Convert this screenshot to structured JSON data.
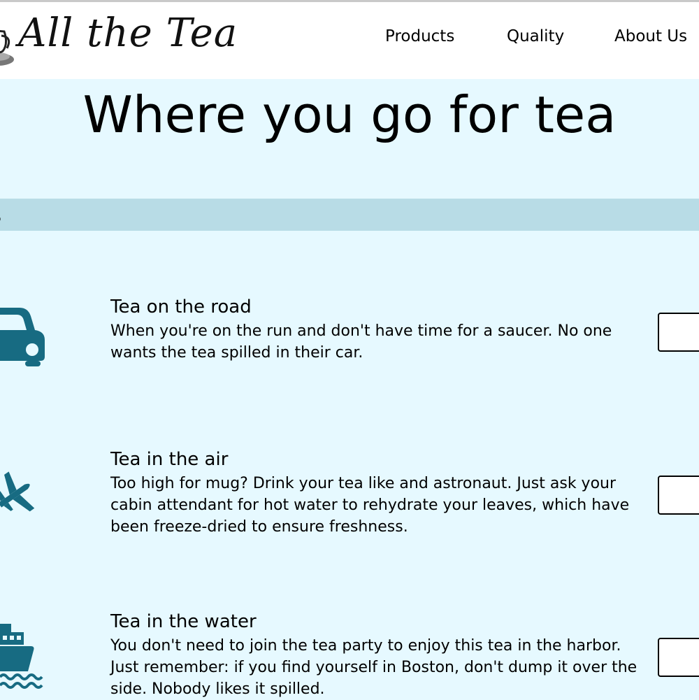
{
  "header": {
    "logo_text": "All the Tea",
    "nav": [
      {
        "label": "Products"
      },
      {
        "label": "Quality"
      },
      {
        "label": "About Us"
      }
    ]
  },
  "hero": {
    "title": "Where you go for tea"
  },
  "section": {
    "title_visible_fragment": "ts"
  },
  "products": [
    {
      "icon": "car-icon",
      "title": "Tea on the road",
      "description": "When you're on the run and don't have time for a saucer. No one wants the tea spilled in their car."
    },
    {
      "icon": "airplane-icon",
      "title": "Tea in the air",
      "description": "Too high for mug? Drink your tea like and astronaut. Just ask your cabin attendant for hot water to rehydrate your leaves, which have been freeze-dried to ensure freshness."
    },
    {
      "icon": "ship-icon",
      "title": "Tea in the water",
      "description": "You don't need to join the tea party to enjoy this tea in the harbor. Just remember: if you find yourself in Boston, don't dump it over the side. Nobody likes it spilled."
    }
  ],
  "colors": {
    "background": "#e6f9ff",
    "header_background": "#ffffff",
    "section_bar": "#b8dce6",
    "icon_color": "#176b82"
  }
}
